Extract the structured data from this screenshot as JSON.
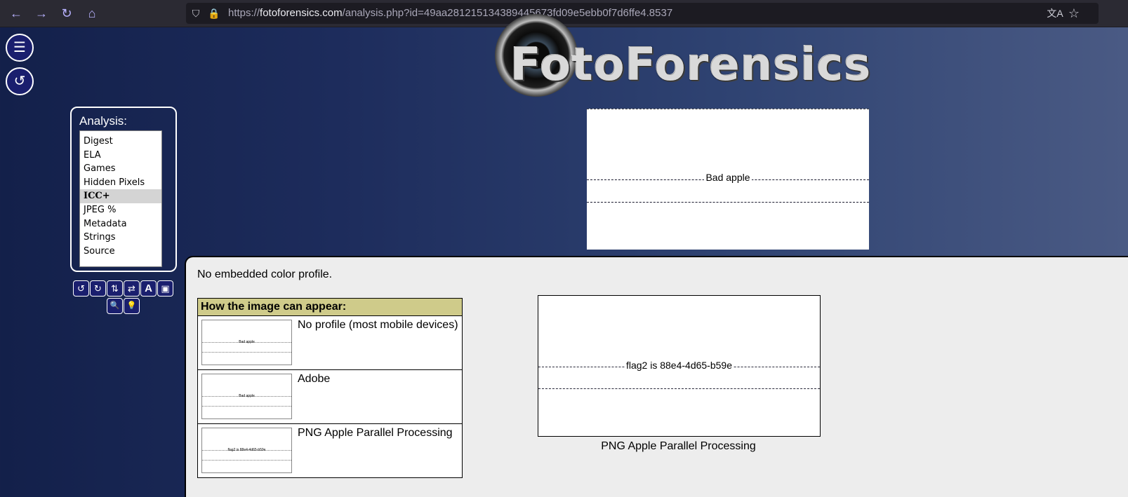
{
  "browser": {
    "url_prefix": "https://",
    "url_host": "fotoforensics.com",
    "url_path": "/analysis.php?id=49aa281215134389445673fd09e5ebb0f7d6ffe4.8537",
    "back_icon": "←",
    "forward_icon": "→",
    "reload_icon": "↻",
    "home_icon": "⌂",
    "shield_icon": "⛉",
    "lock_icon": "🔒",
    "translate_icon": "文A",
    "bookmark_icon": "☆"
  },
  "sidebar": {
    "menu_icon": "☰",
    "refresh_icon": "↺"
  },
  "logo": {
    "text": "FotoForensics"
  },
  "analysis": {
    "title": "Analysis:",
    "items": [
      {
        "label": "Digest"
      },
      {
        "label": "ELA"
      },
      {
        "label": "Games"
      },
      {
        "label": "Hidden Pixels"
      },
      {
        "label": "ICC+"
      },
      {
        "label": "JPEG %"
      },
      {
        "label": "Metadata"
      },
      {
        "label": "Strings"
      },
      {
        "label": "Source"
      }
    ],
    "selected": "ICC+"
  },
  "tools": {
    "rotate_left": "↺",
    "rotate_right": "↻",
    "flip_vertical": "⇅",
    "flip_horizontal": "⇄",
    "font": "A",
    "fit": "▣",
    "zoom": "🔍",
    "hint": "💡"
  },
  "preview": {
    "caption": "Bad apple"
  },
  "content": {
    "no_profile_text": "No embedded color profile.",
    "appear_header": "How the image can appear:",
    "rows": [
      {
        "label": "No profile (most mobile devices)",
        "thumb_caption": "Bad apple"
      },
      {
        "label": "Adobe",
        "thumb_caption": "Bad apple"
      },
      {
        "label": "PNG Apple Parallel Processing",
        "thumb_caption": "flag2 is 88e4-4d65-b59e"
      }
    ],
    "big_caption": "flag2 is 88e4-4d65-b59e",
    "big_label": "PNG Apple Parallel Processing"
  }
}
